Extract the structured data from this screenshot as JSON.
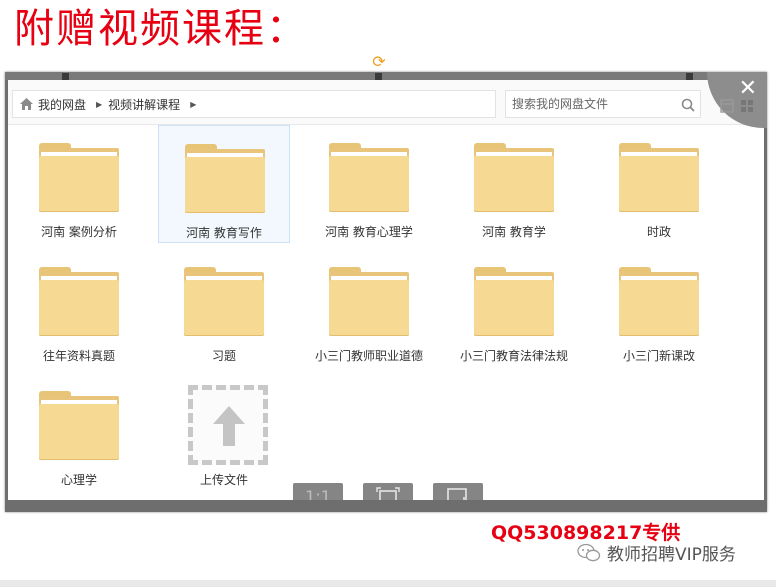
{
  "headline": "附赠视频课程：",
  "breadcrumb": {
    "home_label": "我的网盘",
    "current_label": "视频讲解课程"
  },
  "search": {
    "placeholder": "搜索我的网盘文件"
  },
  "folders": [
    {
      "name": "河南 案例分析",
      "selected": false
    },
    {
      "name": "河南 教育写作",
      "selected": true
    },
    {
      "name": "河南 教育心理学",
      "selected": false
    },
    {
      "name": "河南 教育学",
      "selected": false
    },
    {
      "name": "时政",
      "selected": false
    },
    {
      "name": "往年资料真题",
      "selected": false
    },
    {
      "name": "习题",
      "selected": false
    },
    {
      "name": "小三门教师职业道德",
      "selected": false
    },
    {
      "name": "小三门教育法律法规",
      "selected": false
    },
    {
      "name": "小三门新课改",
      "selected": false
    },
    {
      "name": "心理学",
      "selected": false
    }
  ],
  "upload": {
    "label": "上传文件"
  },
  "viewer_toolbar": {
    "actual_size_label": "1:1"
  },
  "footer": {
    "qq_text": "QQ530898217专供",
    "brand_text": "教师招聘VIP服务"
  },
  "colors": {
    "accent_red": "#e60012",
    "folder_yellow": "#f6d992",
    "viewer_frame": "#6e6e6e"
  },
  "icons": {
    "home": "home-icon",
    "search": "search-icon",
    "close": "close-icon",
    "rotate": "rotate-icon",
    "upload": "upload-arrow-icon",
    "wechat": "wechat-icon"
  }
}
